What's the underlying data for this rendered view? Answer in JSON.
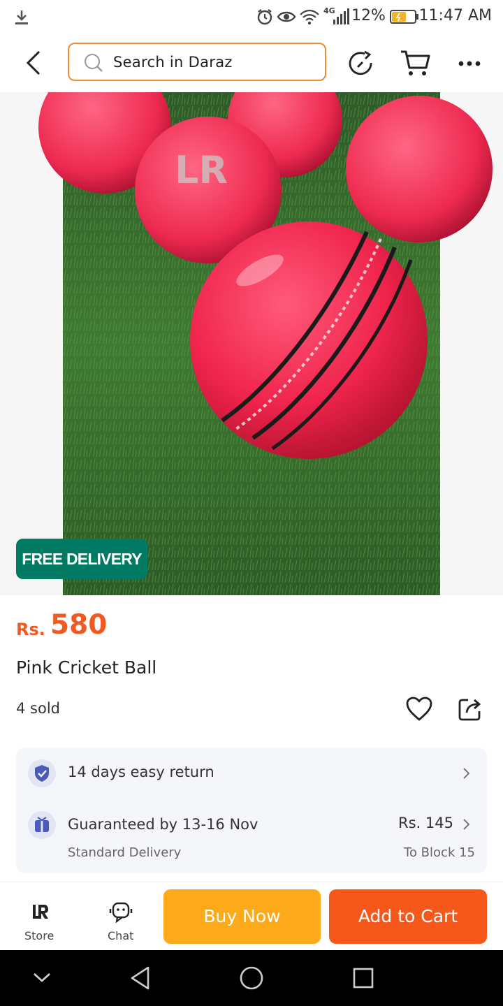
{
  "status_bar": {
    "network": "4G",
    "battery": "12%",
    "time": "11:47 AM"
  },
  "header": {
    "search_placeholder": "Search in Daraz"
  },
  "product": {
    "badge": "FREE DELIVERY",
    "currency": "Rs.",
    "price": "580",
    "title": "Pink Cricket Ball",
    "sold": "4 sold"
  },
  "services": {
    "return_text": "14 days easy return",
    "delivery_title": "Guaranteed by 13-16 Nov",
    "delivery_sub": "Standard Delivery",
    "delivery_fee": "Rs. 145",
    "delivery_location": "To Block 15"
  },
  "bottom_bar": {
    "store_label": "Store",
    "chat_label": "Chat",
    "buy_now": "Buy Now",
    "add_to_cart": "Add to Cart"
  },
  "colors": {
    "accent": "#f05a22",
    "buy_now": "#fcaa1a",
    "add_to_cart": "#f6581c",
    "badge": "#007a63"
  }
}
